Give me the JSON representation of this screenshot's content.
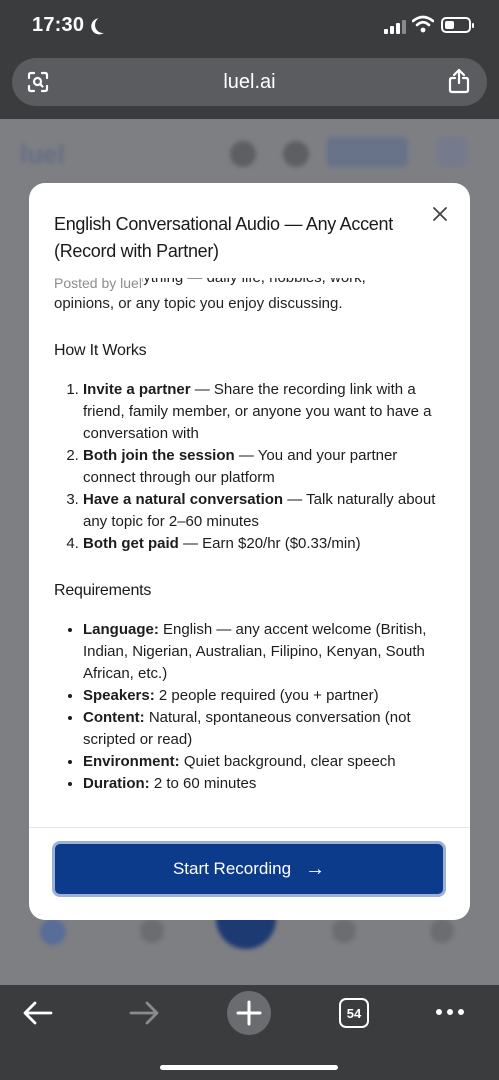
{
  "status_bar": {
    "time": "17:30"
  },
  "browser": {
    "url": "luel.ai",
    "tab_count": "54"
  },
  "modal": {
    "title": "English Conversational Audio — Any Accent (Record with Partner)",
    "posted_by": "Posted by luel",
    "clipped_text": "Talk about anything — daily life, hobbies, work,",
    "intro_visible": "opinions, or any topic you enjoy discussing.",
    "how_it_works": {
      "heading": "How It Works",
      "steps": [
        {
          "bold": "Invite a partner",
          "text": " — Share the recording link with a friend, family member, or anyone you want to have a conversation with"
        },
        {
          "bold": "Both join the session",
          "text": " — You and your partner connect through our platform"
        },
        {
          "bold": "Have a natural conversation",
          "text": " — Talk naturally about any topic for 2–60 minutes"
        },
        {
          "bold": "Both get paid",
          "text": " — Earn $20/hr ($0.33/min)"
        }
      ]
    },
    "requirements": {
      "heading": "Requirements",
      "items": [
        {
          "bold": "Language:",
          "text": " English — any accent welcome (British, Indian, Nigerian, Australian, Filipino, Kenyan, South African, etc.)"
        },
        {
          "bold": "Speakers:",
          "text": " 2 people required (you + partner)"
        },
        {
          "bold": "Content:",
          "text": " Natural, spontaneous conversation (not scripted or read)"
        },
        {
          "bold": "Environment:",
          "text": " Quiet background, clear speech"
        },
        {
          "bold": "Duration:",
          "text": " 2 to 60 minutes"
        }
      ]
    },
    "cta_label": "Start Recording",
    "cta_arrow": "→"
  },
  "background_page": {
    "logo": "luel"
  },
  "colors": {
    "primary": "#0b3b8a",
    "chrome": "#3b3c3e"
  }
}
